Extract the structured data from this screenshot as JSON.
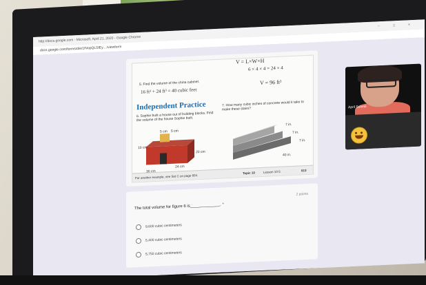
{
  "browser": {
    "title": "http://docs.google.com - Microsoft, April 21, 2020 - Google Chrome",
    "url": "docs.google.com/forms/d/e/1FAIpQLSfEy..../viewform",
    "window_controls": [
      "–",
      "□",
      "×"
    ]
  },
  "worksheet": {
    "handwriting_top": "V = L×W×H",
    "handwriting_right": "6 × 4 × 4  =  24 × 4",
    "handwriting_volume": "V = 96 ft³",
    "problem5": "5. Find the volume of the china cabinet.",
    "handwriting_sum": "16 ft³ + 24 ft³ = 40 cubic feet",
    "title": "Independent Practice",
    "problem6": "6. Sophie built a house out of building blocks. Find the volume of the house Sophie built.",
    "problem7": "7. How many cubic inches of concrete would it take to make these stairs?",
    "dim_5cm_a": "5 cm",
    "dim_5cm_b": "5 cm",
    "dim_10cm": "10 cm",
    "dim_20cm": "20 cm",
    "dim_24cm": "24 cm",
    "dim_30cm": "30 cm",
    "stair_7in_a": "7 in.",
    "stair_7in_b": "7 in.",
    "stair_7in_c": "7 in.",
    "stair_40in": "40 in.",
    "footer_left": "For another example, see Set C on page 604.",
    "footer_topic": "Topic 10",
    "footer_lesson": "Lesson 10-5",
    "footer_page": "613"
  },
  "question": {
    "text": "The total volume for figure 6 is_____________.",
    "required": "*",
    "points": "2 points",
    "options": [
      "9,600 cubic centimeters",
      "5,400 cubic centimeters",
      "5,750 cubic centimeters"
    ]
  },
  "video": {
    "name": "April Schmit"
  }
}
